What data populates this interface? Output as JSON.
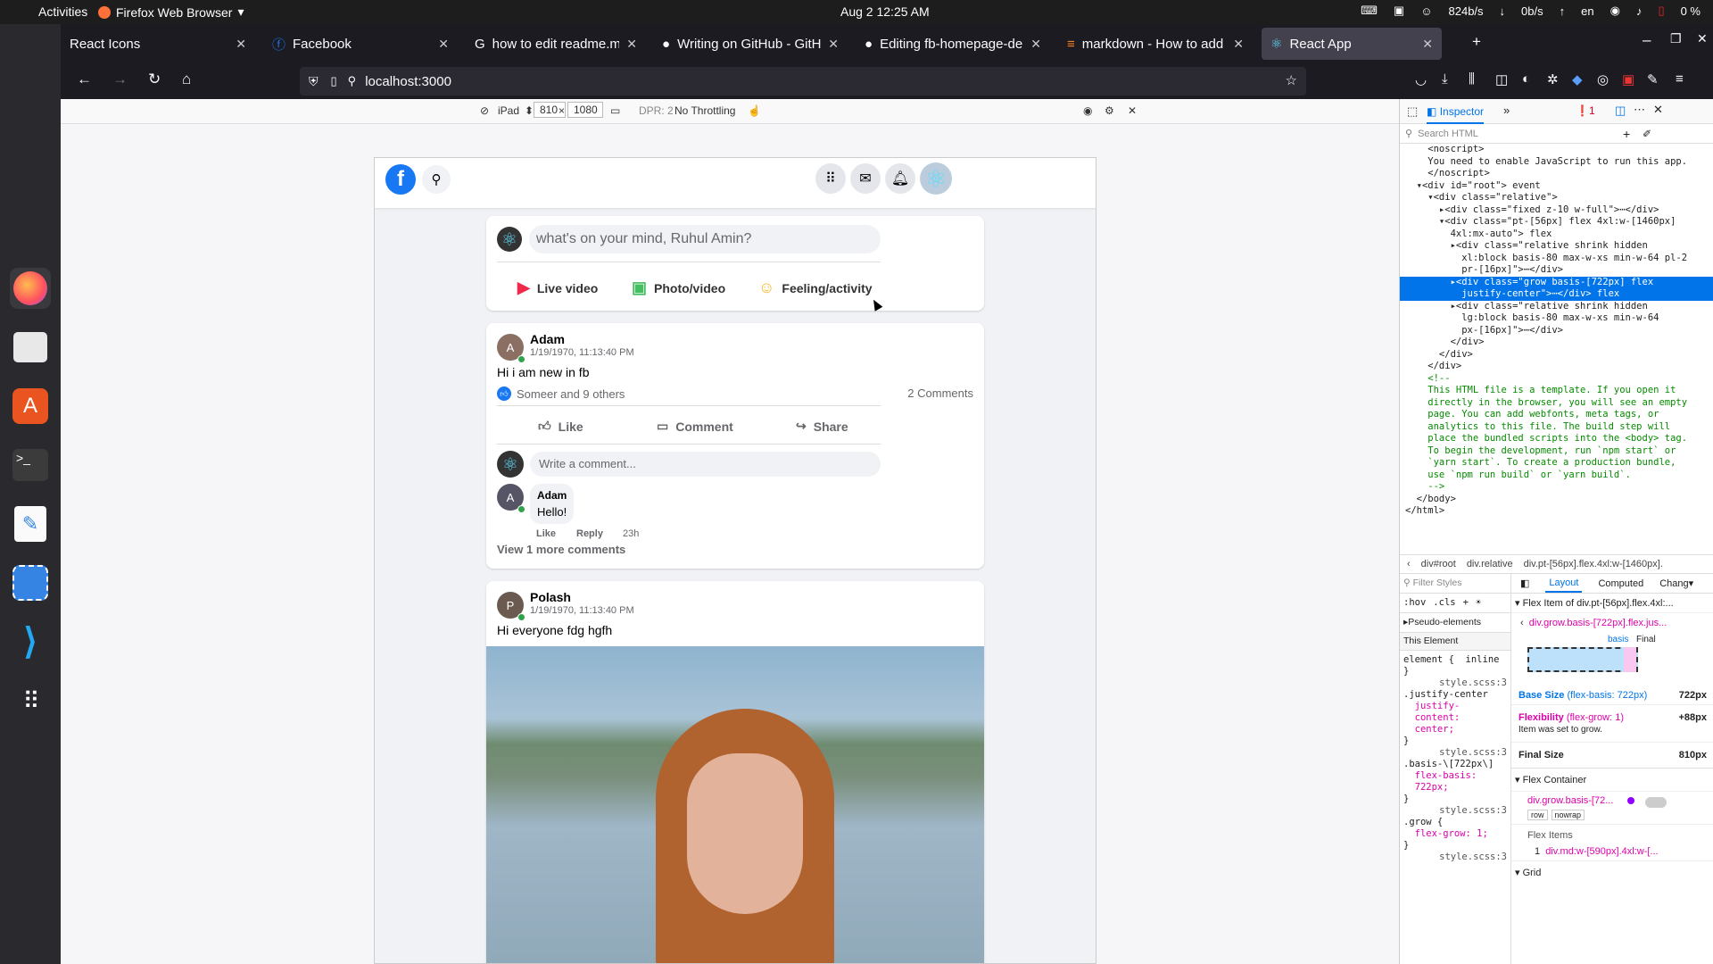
{
  "system": {
    "activities": "Activities",
    "app_name": "Firefox Web Browser",
    "clock": "Aug 2  12:25 AM",
    "net_down": "824b/s",
    "net_up": "0b/s",
    "lang": "en",
    "battery": "0 %"
  },
  "dock": [
    "firefox-icon",
    "files-icon",
    "software-center-icon",
    "terminal-icon",
    "text-editor-icon",
    "screenshot-icon",
    "vscode-icon",
    "apps-grid-icon"
  ],
  "tabs": [
    {
      "label": "React Icons"
    },
    {
      "label": "Facebook"
    },
    {
      "label": "how to edit readme.md -"
    },
    {
      "label": "Writing on GitHub - GitHu"
    },
    {
      "label": "Editing fb-homepage-de"
    },
    {
      "label": "markdown - How to add"
    },
    {
      "label": "React App"
    }
  ],
  "url": "localhost:3000",
  "rdm": {
    "device": "iPad",
    "width": "810",
    "times": "×",
    "height": "1080",
    "dpr": "DPR: 2",
    "throttling": "No Throttling"
  },
  "composer": {
    "placeholder": "what's on your mind, Ruhul Amin?",
    "live": "Live video",
    "photo": "Photo/video",
    "feeling": "Feeling/activity"
  },
  "post1": {
    "author": "Adam",
    "time": "1/19/1970, 11:13:40 PM",
    "text": "Hi i am new in fb",
    "likes": "Someer and 9 others",
    "comments": "2 Comments",
    "like": "Like",
    "comment": "Comment",
    "share": "Share",
    "write_placeholder": "Write a comment...",
    "c_author": "Adam",
    "c_text": "Hello!",
    "c_like": "Like",
    "c_reply": "Reply",
    "c_time": "23h",
    "more": "View 1 more comments"
  },
  "post2": {
    "author": "Polash",
    "time": "1/19/1970, 11:13:40 PM",
    "text": "Hi everyone fdg hgfh"
  },
  "devtools": {
    "inspector": "Inspector",
    "errors": "1",
    "search_placeholder": "Search HTML",
    "code": [
      "    <noscript>",
      "    You need to enable JavaScript to run this app.",
      "    </noscript>",
      "  ▾<div id=\"root\"> event",
      "    ▾<div class=\"relative\">",
      "      ▸<div class=\"fixed z-10 w-full\">⋯</div>",
      "      ▾<div class=\"pt-[56px] flex 4xl:w-[1460px]",
      "        4xl:mx-auto\"> flex",
      "        ▸<div class=\"relative shrink hidden",
      "          xl:block basis-80 max-w-xs min-w-64 pl-2",
      "          pr-[16px]\">⋯</div>",
      "        ▸<div class=\"grow basis-[722px] flex",
      "          justify-center\">⋯</div> flex",
      "        ▸<div class=\"relative shrink hidden",
      "          lg:block basis-80 max-w-xs min-w-64",
      "          px-[16px]\">⋯</div>",
      "        </div>",
      "      </div>",
      "    </div>",
      "    <!--",
      "    This HTML file is a template. If you open it",
      "    directly in the browser, you will see an empty",
      "    page. You can add webfonts, meta tags, or",
      "    analytics to this file. The build step will",
      "    place the bundled scripts into the <body> tag.",
      "    To begin the development, run `npm start` or",
      "    `yarn start`. To create a production bundle,",
      "    use `npm run build` or `yarn build`.",
      "    -->",
      "  </body>",
      "</html>"
    ],
    "breadcrumbs": [
      "div#root",
      "div.relative",
      "div.pt-[56px].flex.4xl:w-[1460px]."
    ],
    "filter_styles": "Filter Styles",
    "hov": ":hov",
    "cls": ".cls",
    "layout_tab": "Layout",
    "computed_tab": "Computed",
    "changes_tab": "Chang",
    "pseudo": "Pseudo-elements",
    "this_element": "This Element",
    "rules": [
      "element {  inline",
      "}",
      "style.scss:3",
      ".justify-center",
      "  justify-",
      "  content:",
      "  center;",
      "}",
      "style.scss:3",
      ".basis-\\[722px\\]",
      "  flex-basis:",
      "  722px;",
      "}",
      "style.scss:3",
      ".grow {",
      "  flex-grow: 1;",
      "}",
      "style.scss:3"
    ],
    "flex_item": "Flex Item of div.pt-[56px].flex.4xl:...",
    "flex_item_sel": "div.grow.basis-[722px].flex.jus...",
    "basis": "basis",
    "final": "Final",
    "base_size": "Base Size",
    "base_size_note": "(flex-basis: 722px)",
    "base_size_val": "722px",
    "flexibility": "Flexibility",
    "flexibility_note": "(flex-grow: 1)",
    "flexibility_val": "+88px",
    "flex_note2": "Item was set to grow.",
    "final_size": "Final Size",
    "final_size_val": "810px",
    "flex_container": "Flex Container",
    "container_sel": "div.grow.basis-[72...",
    "row": "row",
    "nowrap": "nowrap",
    "flex_items": "Flex Items",
    "flex_item1_n": "1",
    "flex_item1": "div.md:w-[590px].4xl:w-[...",
    "grid": "Grid"
  }
}
